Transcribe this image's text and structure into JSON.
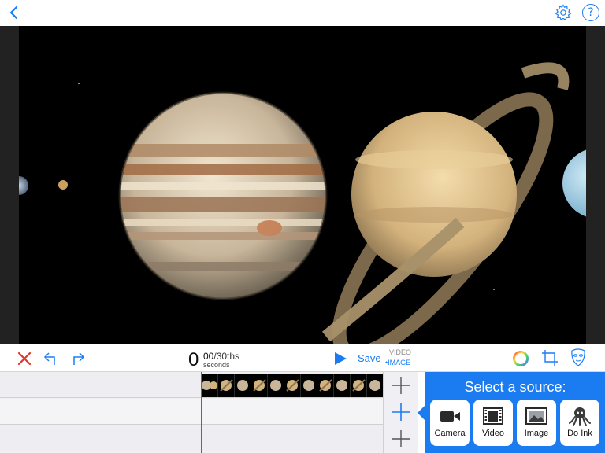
{
  "header": {
    "back_icon": "chevron-left-icon",
    "settings_icon": "gear-icon",
    "help_label": "?"
  },
  "stage": {
    "description_icon": "planets-image"
  },
  "controls": {
    "delete_icon": "close-icon",
    "undo_icon": "undo-icon",
    "redo_icon": "redo-icon",
    "time_seconds": "0",
    "time_frames": "00",
    "time_frames_unit": "/30ths",
    "time_unit_label": "seconds",
    "play_icon": "play-icon",
    "save_label": "Save",
    "mode_video_label": "VIDEO",
    "mode_image_label": "•IMAGE",
    "color_icon": "color-wheel-icon",
    "crop_icon": "crop-icon",
    "mask_icon": "mask-icon"
  },
  "timeline": {
    "add_icon": "plus-icon"
  },
  "source_panel": {
    "title": "Select a source:",
    "buttons": [
      {
        "label": "Camera",
        "icon": "video-camera-icon"
      },
      {
        "label": "Video",
        "icon": "film-icon"
      },
      {
        "label": "Image",
        "icon": "image-icon"
      },
      {
        "label": "Do Ink",
        "icon": "octopus-icon"
      }
    ]
  },
  "colors": {
    "accent": "#1b7cf2",
    "playhead": "#e0362c",
    "delete": "#e0362c"
  }
}
